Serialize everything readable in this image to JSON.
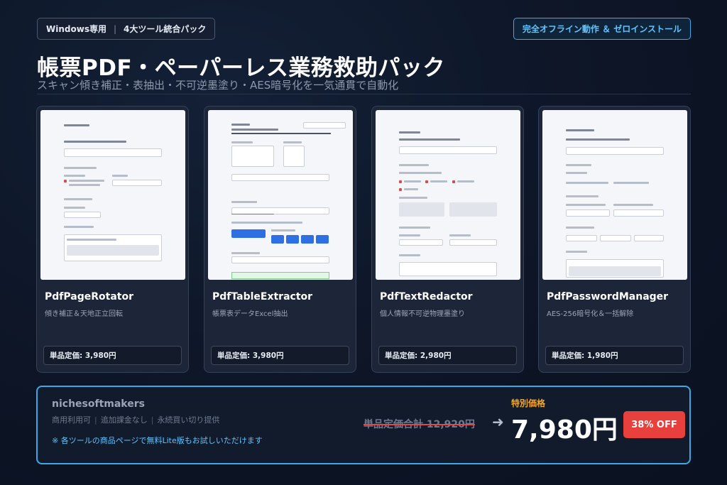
{
  "header": {
    "platform_badge": "Windows専用",
    "pack_badge": "4大ツール統合パック",
    "offline_badge": "完全オフライン動作 ＆ ゼロインストール",
    "title": "帳票PDF・ペーパーレス業務救助パック",
    "subtitle": "スキャン傾き補正・表抽出・不可逆墨塗り・AES暗号化を一気通貫で自動化"
  },
  "products": [
    {
      "name": "PdfPageRotator",
      "description": "傾き補正＆天地正立回転",
      "price": "単品定価: 3,980円"
    },
    {
      "name": "PdfTableExtractor",
      "description": "帳票表データExcel抽出",
      "price": "単品定価: 3,980円"
    },
    {
      "name": "PdfTextRedactor",
      "description": "個人情報不可逆物理墨塗り",
      "price": "単品定価: 2,980円"
    },
    {
      "name": "PdfPasswordManager",
      "description": "AES-256暗号化＆一括解除",
      "price": "単品定価: 1,980円"
    }
  ],
  "bundle": {
    "brand": "nichesoftmakers",
    "terms": [
      "商用利用可",
      "追加課金なし",
      "永続買い切り提供"
    ],
    "note": "※ 各ツールの商品ページで無料Lite版もお試しいただけます",
    "original_total": "単品定価合計 12,920円",
    "arrow": "➜",
    "special_label": "特別価格",
    "special_price": "7,980円",
    "discount": "38% OFF"
  },
  "colors": {
    "accent": "#3ba9e6",
    "special_label": "#f5a623",
    "discount_badge": "#e8413d",
    "background": "#0d1526"
  }
}
